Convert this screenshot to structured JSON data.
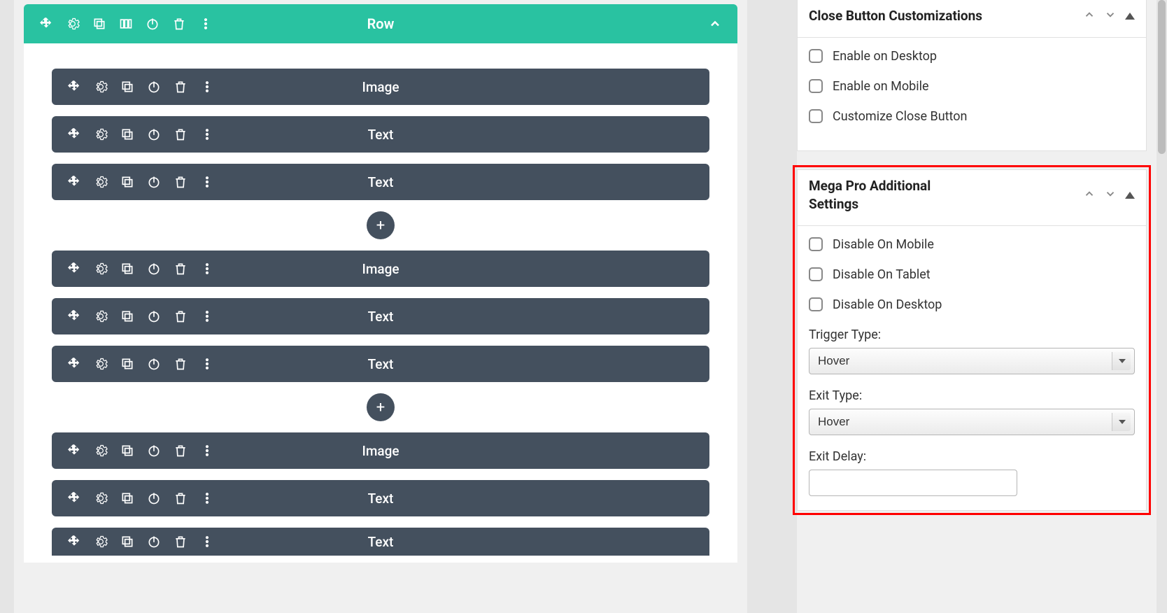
{
  "row": {
    "title": "Row",
    "groups": [
      {
        "blocks": [
          "Image",
          "Text",
          "Text"
        ]
      },
      {
        "blocks": [
          "Image",
          "Text",
          "Text"
        ]
      },
      {
        "blocks": [
          "Image",
          "Text",
          "Text"
        ]
      }
    ]
  },
  "panel1": {
    "title": "Close Button Customizations",
    "checks": [
      "Enable on Desktop",
      "Enable on Mobile",
      "Customize Close Button"
    ]
  },
  "panel2": {
    "title": "Mega Pro Additional Settings",
    "checks": [
      "Disable On Mobile",
      "Disable On Tablet",
      "Disable On Desktop"
    ],
    "trigger_label": "Trigger Type:",
    "trigger_value": "Hover",
    "exit_label": "Exit Type:",
    "exit_value": "Hover",
    "delay_label": "Exit Delay:",
    "delay_value": ""
  }
}
